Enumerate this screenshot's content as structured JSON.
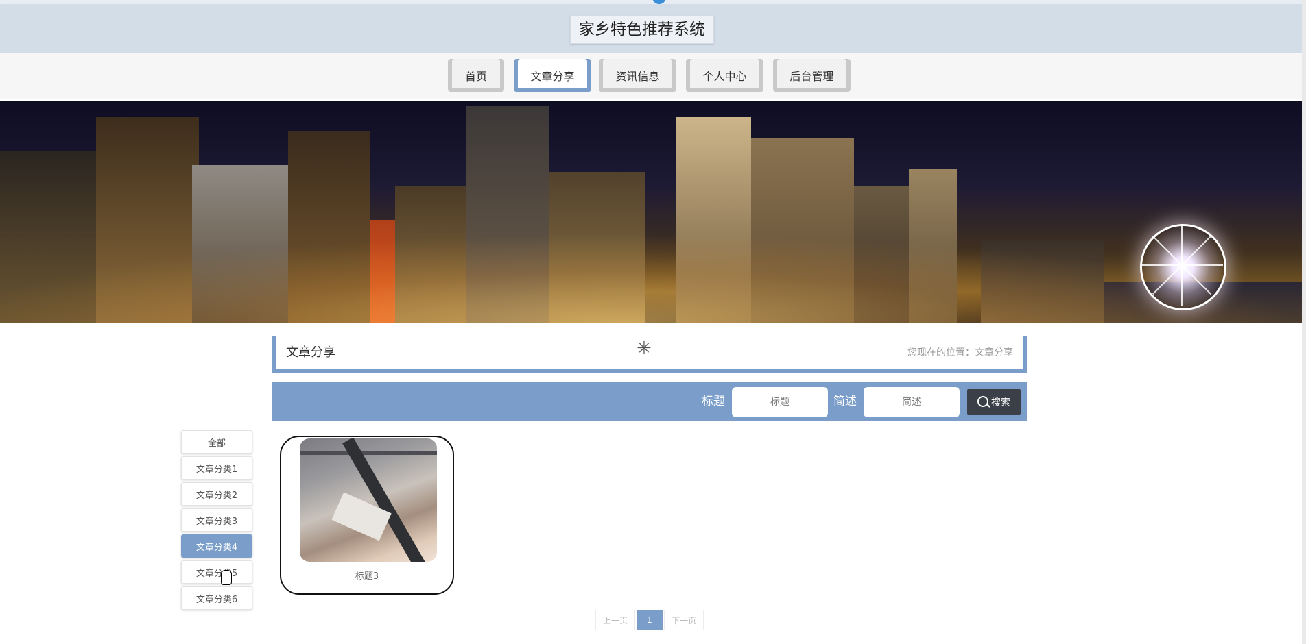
{
  "site": {
    "title": "家乡特色推荐系统"
  },
  "nav": {
    "items": [
      {
        "label": "首页"
      },
      {
        "label": "文章分享",
        "active": true
      },
      {
        "label": "资讯信息"
      },
      {
        "label": "个人中心"
      },
      {
        "label": "后台管理"
      }
    ]
  },
  "section": {
    "title": "文章分享",
    "breadcrumb": "您现在的位置：文章分享"
  },
  "search": {
    "title_label": "标题",
    "title_placeholder": "标题",
    "desc_label": "简述",
    "desc_placeholder": "简述",
    "button_label": "搜索"
  },
  "categories": [
    {
      "label": "全部"
    },
    {
      "label": "文章分类1"
    },
    {
      "label": "文章分类2"
    },
    {
      "label": "文章分类3"
    },
    {
      "label": "文章分类4",
      "active": true
    },
    {
      "label": "文章分类5"
    },
    {
      "label": "文章分类6"
    }
  ],
  "articles": [
    {
      "title": "标题3"
    }
  ],
  "pagination": {
    "prev": "上一页",
    "current": "1",
    "next": "下一页"
  },
  "colors": {
    "accent": "#7a9ec9",
    "header_bg": "#d3dde8",
    "search_button": "#3b4048"
  }
}
